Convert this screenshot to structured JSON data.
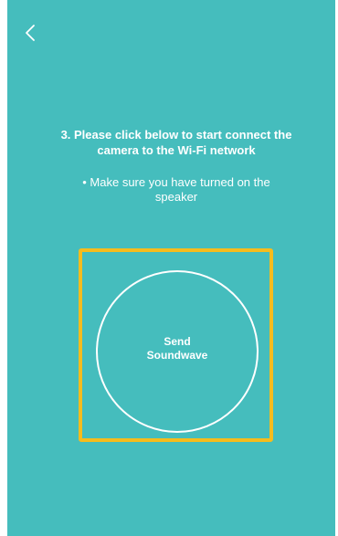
{
  "header": {
    "back_icon": "chevron-left-icon"
  },
  "instructions": {
    "title": "3. Please click below to start connect the camera to the Wi-Fi network",
    "hint": "• Make sure you have turned on the speaker"
  },
  "send_button": {
    "line1": "Send",
    "line2": "Soundwave"
  },
  "colors": {
    "background": "#45bdbd",
    "highlight_border": "#f6bc1d",
    "text": "#ffffff"
  }
}
